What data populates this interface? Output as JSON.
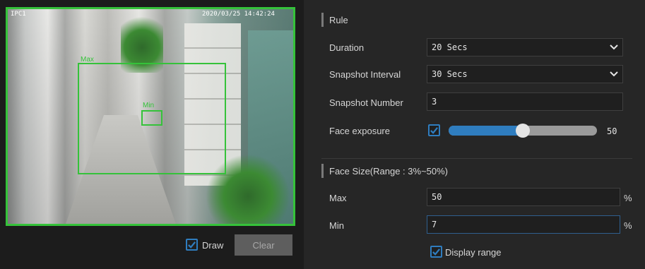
{
  "video": {
    "camera_label": "IPC1",
    "timestamp": "2020/03/25 14:42:24",
    "roi_max_label": "Max",
    "roi_min_label": "Min"
  },
  "draw": {
    "label": "Draw",
    "checked": true
  },
  "clear_button": {
    "label": "Clear"
  },
  "rule": {
    "title": "Rule",
    "duration": {
      "label": "Duration",
      "value": "20 Secs"
    },
    "snapshot_interval": {
      "label": "Snapshot Interval",
      "value": "30 Secs"
    },
    "snapshot_number": {
      "label": "Snapshot Number",
      "value": "3"
    },
    "face_exposure": {
      "label": "Face exposure",
      "checked": true,
      "value": "50",
      "level": 0.5
    }
  },
  "face_size": {
    "title": "Face Size(Range : 3%~50%)",
    "max": {
      "label": "Max",
      "value": "50",
      "unit": "%"
    },
    "min": {
      "label": "Min",
      "value": "7",
      "unit": "%"
    },
    "display_range": {
      "label": "Display range",
      "checked": true
    }
  },
  "colors": {
    "accent": "#2f7dbf",
    "roi": "#35c23a",
    "panel": "#262626"
  }
}
